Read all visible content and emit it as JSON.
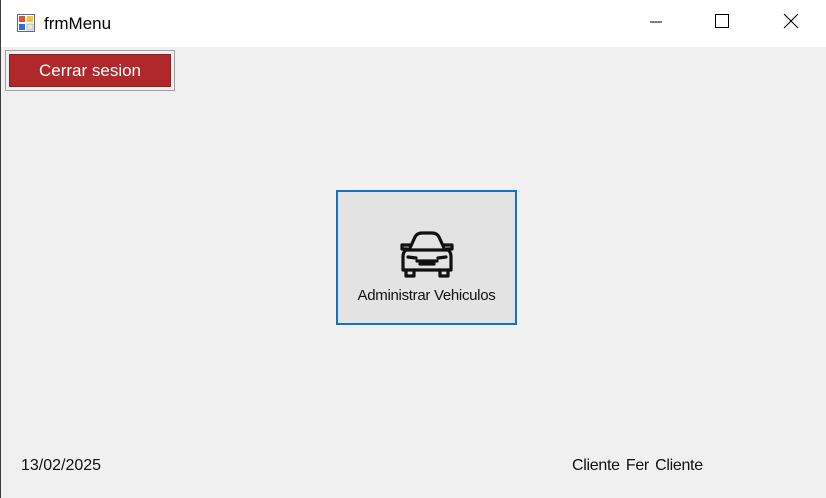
{
  "window": {
    "title": "frmMenu",
    "icon": "form-icon",
    "controls": {
      "minimize_icon": "minimize-icon",
      "maximize_icon": "maximize-icon",
      "close_icon": "close-icon"
    }
  },
  "toolbar": {
    "logout_label": "Cerrar sesion",
    "logout_color": "#b0282a"
  },
  "main": {
    "tiles": [
      {
        "label": "Administrar Vehiculos",
        "icon": "car-icon",
        "accent": "#0f72d3"
      }
    ]
  },
  "footer": {
    "date": "13/02/2025",
    "user": "Cliente Fer Cliente"
  }
}
